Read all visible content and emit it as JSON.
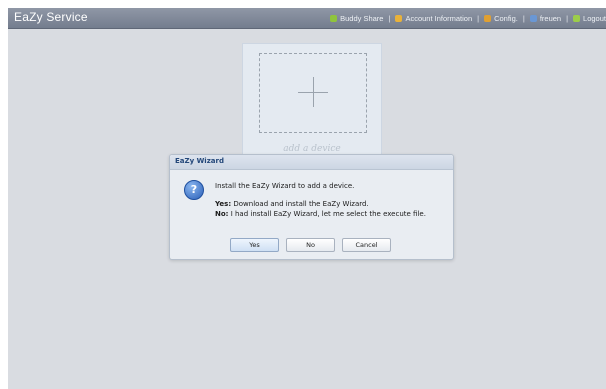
{
  "app": {
    "title": "EaZy Service"
  },
  "nav": {
    "buddy_share": "Buddy Share",
    "account_information": "Account Information",
    "config": "Config.",
    "user": "freuen",
    "logout": "Logout",
    "separator": "|"
  },
  "device_card": {
    "label": "add a device"
  },
  "dialog": {
    "title": "EaZy Wizard",
    "message": "Install the EaZy Wizard to add a device.",
    "yes_label": "Yes:",
    "yes_text": "Download and install the EaZy Wizard.",
    "no_label": "No:",
    "no_text": "I had install EaZy Wizard, let me select the execute file.",
    "buttons": {
      "yes": "Yes",
      "no": "No",
      "cancel": "Cancel"
    },
    "icon": "question-icon"
  },
  "colors": {
    "topbar": "#7f8898",
    "background": "#d9dce1",
    "accent": "#24487a"
  }
}
